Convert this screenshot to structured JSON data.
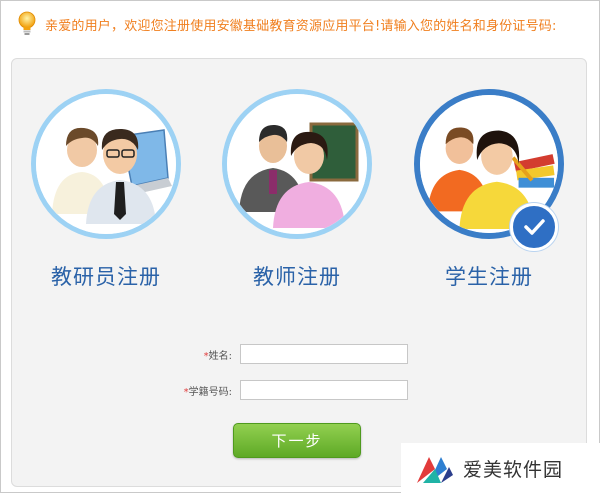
{
  "notice": {
    "icon": "lightbulb-icon",
    "text": "亲爱的用户，欢迎您注册使用安徽基础教育资源应用平台!请输入您的姓名和身份证号码:"
  },
  "roles": [
    {
      "label": "教研员注册",
      "icon": "teacher-researcher-avatar",
      "selected": false
    },
    {
      "label": "教师注册",
      "icon": "teacher-avatar",
      "selected": false
    },
    {
      "label": "学生注册",
      "icon": "student-avatar",
      "selected": true
    }
  ],
  "form": {
    "name_label": "姓名:",
    "name_value": "",
    "student_id_label": "学籍号码:",
    "student_id_value": "",
    "required_mark": "*"
  },
  "next_button": "下一步",
  "watermark": {
    "text": "爱美软件园",
    "icon": "watermark-logo-icon"
  },
  "colors": {
    "notice_text": "#f07f1f",
    "role_label": "#2a62a8",
    "selected_ring": "#3a7dc7",
    "unselected_ring": "#9dd2f4",
    "button_green": "#6fb62f",
    "required": "#e03b3b"
  }
}
